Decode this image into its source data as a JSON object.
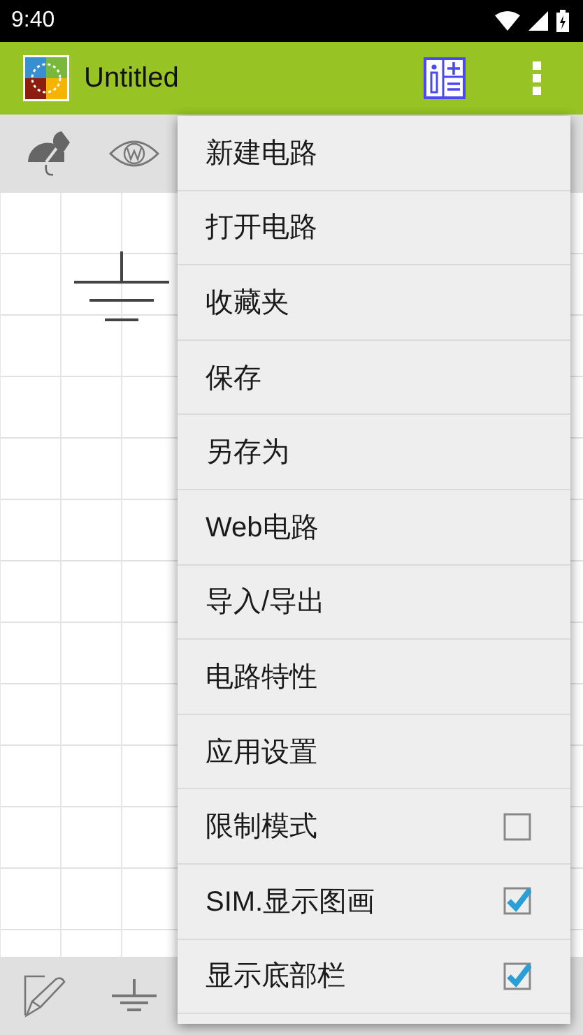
{
  "status_bar": {
    "time": "9:40"
  },
  "app_bar": {
    "title": "Untitled"
  },
  "menu": {
    "items": [
      {
        "label": "新建电路",
        "kind": "plain"
      },
      {
        "label": "打开电路",
        "kind": "plain"
      },
      {
        "label": "收藏夹",
        "kind": "plain"
      },
      {
        "label": "保存",
        "kind": "plain"
      },
      {
        "label": "另存为",
        "kind": "plain"
      },
      {
        "label": "Web电路",
        "kind": "plain"
      },
      {
        "label": "导入/导出",
        "kind": "plain"
      },
      {
        "label": "电路特性",
        "kind": "plain"
      },
      {
        "label": "应用设置",
        "kind": "plain"
      },
      {
        "label": "限制模式",
        "kind": "check",
        "checked": false
      },
      {
        "label": "SIM.显示图画",
        "kind": "check",
        "checked": true
      },
      {
        "label": "显示底部栏",
        "kind": "check",
        "checked": true
      }
    ]
  }
}
